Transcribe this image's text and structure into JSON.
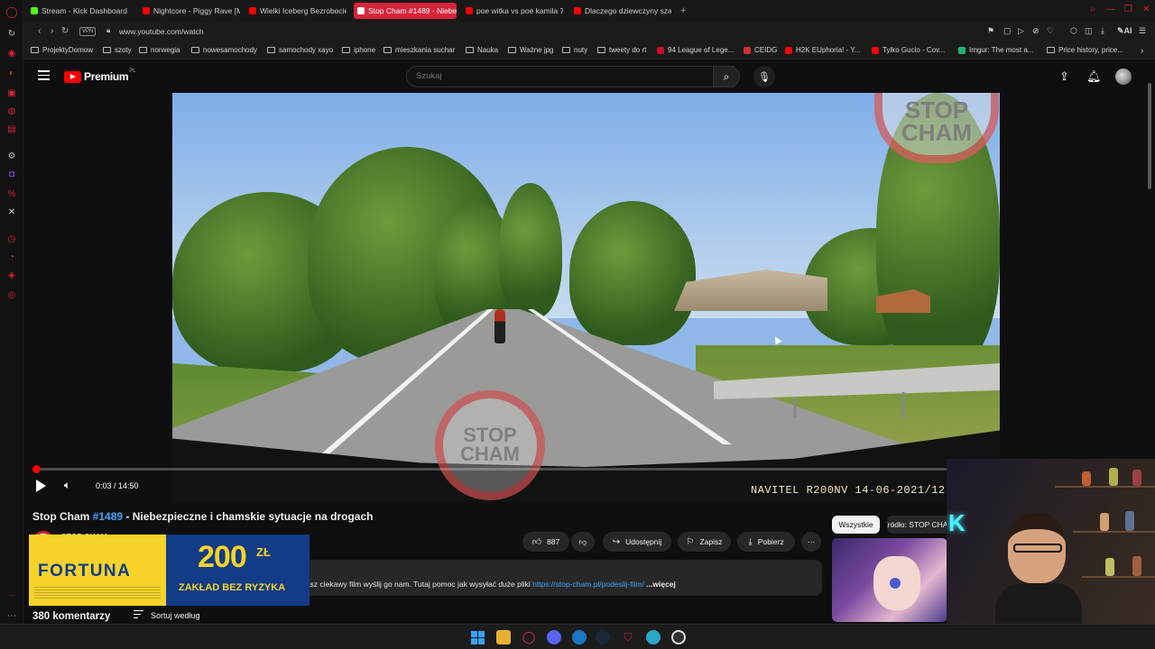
{
  "browser": {
    "tabs": [
      {
        "label": "Stream - Kick Dashboard",
        "color": "#53fc18",
        "active": false
      },
      {
        "label": "Nightcore - Piggy Rave [M",
        "color": "#ff0000",
        "active": false
      },
      {
        "label": "Wielki Iceberg Bezrobocie",
        "color": "#ff0000",
        "active": false
      },
      {
        "label": "Stop Cham #1489 - Niebe",
        "color": "#ff0000",
        "active": true
      },
      {
        "label": "poe witka vs poe kamila 7",
        "color": "#ff0000",
        "active": false
      },
      {
        "label": "Dlaczego dziewczyny szan",
        "color": "#ff0000",
        "active": false
      }
    ],
    "new_tab": "+",
    "vpn": "VPN",
    "url": "www.youtube.com/watch",
    "ai_label": "AI",
    "bookmarks": [
      {
        "label": "ProjektyDomow",
        "type": "folder"
      },
      {
        "label": "szoty",
        "type": "folder"
      },
      {
        "label": "norwegia",
        "type": "folder"
      },
      {
        "label": "nowesamochody",
        "type": "folder"
      },
      {
        "label": "samochody xayo",
        "type": "folder"
      },
      {
        "label": "iphone",
        "type": "folder"
      },
      {
        "label": "mieszkania suchar",
        "type": "folder"
      },
      {
        "label": "Nauka",
        "type": "folder"
      },
      {
        "label": "Ważne jpg",
        "type": "folder"
      },
      {
        "label": "nuty",
        "type": "folder"
      },
      {
        "label": "tweety do rt",
        "type": "folder"
      },
      {
        "label": "94 League of Lege...",
        "type": "site",
        "color": "#c8102e"
      },
      {
        "label": "CEIDG",
        "type": "site",
        "color": "#d03030"
      },
      {
        "label": "H2K EUphoria! - Y...",
        "type": "site",
        "color": "#ff0000"
      },
      {
        "label": "Tylko Gucio - Cov...",
        "type": "site",
        "color": "#ff0000"
      },
      {
        "label": "Imgur: The most a...",
        "type": "site",
        "color": "#1bb76e"
      },
      {
        "label": "Price history, price...",
        "type": "folder"
      }
    ]
  },
  "youtube": {
    "brand": "Premium",
    "region": "PL",
    "search_placeholder": "Szukaj",
    "video": {
      "stamp_top": "STOP CHAM",
      "stamp_bottom_line1": "STOP",
      "stamp_bottom_line2": "CHAM",
      "timestamp_overlay": "NAVITEL R200NV 14-06-2021/12",
      "time": "0:03 / 14:50",
      "progress": 0.0034
    },
    "title_prefix": "Stop Cham ",
    "title_hash": "#1489",
    "title_rest": " - Niebezpieczne i chamskie sytuacje na drogach",
    "channel_name": "STOP CHAM",
    "likes": "887",
    "share_label": "Udostępnij",
    "save_label": "Zapisz",
    "download_label": "Pobierz",
    "description": "dróg. Masz ciekawy film wyślij go nam. Tutaj pomoc jak wysyłać duże pliki ",
    "description_link": "https://stop-cham.pl/podeslij-film/",
    "more_label": " ...więcej",
    "comments_count": "380 komentarzy",
    "sort_label": "Sortuj według",
    "chips": {
      "all": "Wszystkie",
      "source": "Źródło: STOP CHAM"
    }
  },
  "ad": {
    "brand": "FORTUNA",
    "amount": "200",
    "currency": "ZŁ",
    "subtitle": "ZAKŁAD BEZ RYZYKA"
  },
  "webcam": {
    "logo": "K"
  }
}
